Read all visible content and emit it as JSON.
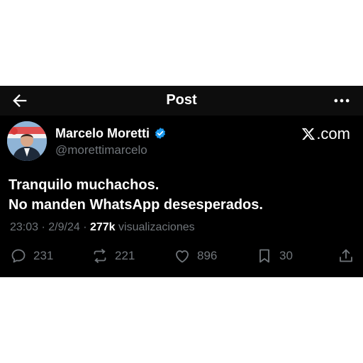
{
  "header": {
    "title": "Post",
    "back_icon": "arrow-left-icon",
    "more_icon": "ellipsis-icon"
  },
  "author": {
    "display_name": "Marcelo Moretti",
    "handle": "@morettimarcelo",
    "verified": true,
    "verified_color": "#1d9bf0"
  },
  "source": {
    "label": ".com"
  },
  "tweet": {
    "lines": [
      "Tranquilo muchachos.",
      "No manden WhatsApp desesperados."
    ]
  },
  "meta": {
    "time": "23:03",
    "separator": " · ",
    "date": "2/9/24",
    "views_count": "277k",
    "views_label": "visualizaciones"
  },
  "actions": {
    "replies": "231",
    "reposts": "221",
    "likes": "896",
    "bookmarks": "30"
  },
  "colors": {
    "background": "#000000",
    "header_bar": "#0d0d0d",
    "text_primary": "#e7e9ea",
    "text_secondary": "#71767b"
  }
}
